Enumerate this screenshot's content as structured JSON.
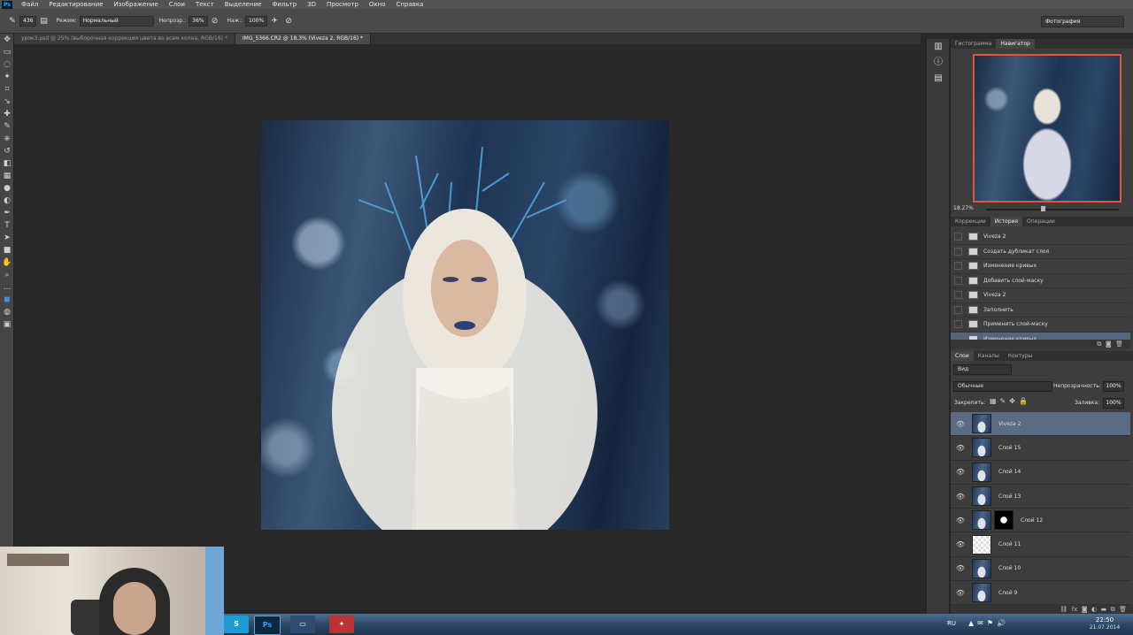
{
  "menu": {
    "items": [
      "Файл",
      "Редактирование",
      "Изображение",
      "Слои",
      "Текст",
      "Выделение",
      "Фильтр",
      "3D",
      "Просмотр",
      "Окно",
      "Справка"
    ]
  },
  "options": {
    "brush_size": "436",
    "mode_label": "Режим:",
    "mode_value": "Нормальный",
    "opacity_label": "Непрозр.:",
    "opacity_value": "36%",
    "flow_label": "Наж.:",
    "flow_value": "100%",
    "workspace": "Фотография"
  },
  "doc_tabs": [
    {
      "label": "урок3.psd @ 25% (выборочная коррекция цвета во всем колна, RGB/16) *"
    },
    {
      "label": "IMG_5366.CR2 @ 18,3% (Viveza 2, RGB/16) *"
    }
  ],
  "navigator": {
    "tabs": [
      "Гистограмма",
      "Навигатор"
    ],
    "zoom": "18.27%"
  },
  "history": {
    "tabs": [
      "Коррекции",
      "История",
      "Операции"
    ],
    "items": [
      "Viveza 2",
      "Создать дубликат слоя",
      "Изменение кривых",
      "Добавить слой-маску",
      "Viveza 2",
      "Заполнить",
      "Применить слой-маску",
      "Изменение кривых"
    ]
  },
  "layers": {
    "tabs": [
      "Слои",
      "Каналы",
      "Контуры"
    ],
    "filter": "Вид",
    "blend": "Обычные",
    "opacity_label": "Непрозрачность:",
    "opacity_value": "100%",
    "lock_label": "Закрепить:",
    "fill_label": "Заливка:",
    "fill_value": "100%",
    "items": [
      {
        "name": "Viveza 2"
      },
      {
        "name": "Слой 15"
      },
      {
        "name": "Слой 14"
      },
      {
        "name": "Слой 13"
      },
      {
        "name": "Слой 12"
      },
      {
        "name": "Слой 11"
      },
      {
        "name": "Слой 10"
      },
      {
        "name": "Слой 9"
      }
    ]
  },
  "taskbar": {
    "lang": "RU",
    "time": "22:50",
    "date": "21.07.2014",
    "apps": [
      "Skype",
      "Ps",
      "Remote",
      "PDF"
    ]
  },
  "colors": {
    "selection": "#5b6b84",
    "navigator_frame": "#e0553e"
  }
}
